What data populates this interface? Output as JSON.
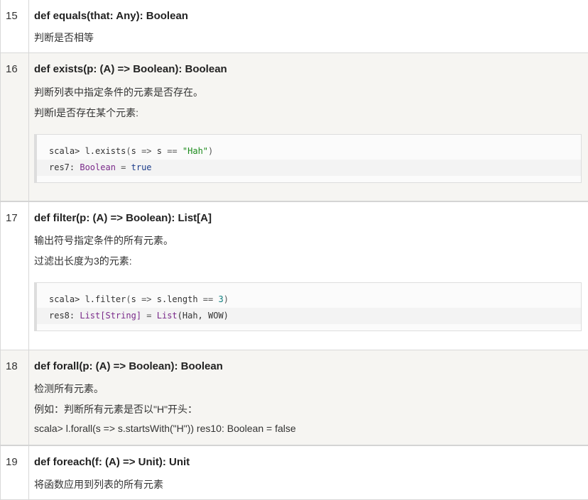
{
  "rows": [
    {
      "num": "15",
      "signature": "def equals(that: Any): Boolean",
      "lines": [
        "判断是否相等"
      ]
    },
    {
      "num": "16",
      "signature": "def exists(p: (A) => Boolean): Boolean",
      "lines": [
        "判断列表中指定条件的元素是否存在。",
        "判断l是否存在某个元素:"
      ],
      "code": {
        "line1": {
          "prompt": "scala> ",
          "call": "l.exists",
          "open": "(",
          "var": "s ",
          "arrow": "=>",
          "rest": " s ",
          "eq": "==",
          "space": " ",
          "str": "\"Hah\"",
          "close": ")"
        },
        "line2": {
          "res": "res7: ",
          "type": "Boolean",
          "eq": " = ",
          "value": "true"
        }
      }
    },
    {
      "num": "17",
      "signature": "def filter(p: (A) => Boolean): List[A]",
      "lines": [
        "输出符号指定条件的所有元素。",
        "过滤出长度为3的元素:"
      ],
      "code": {
        "line1": {
          "prompt": "scala> ",
          "call": "l.filter",
          "open": "(",
          "var": "s ",
          "arrow": "=>",
          "rest": " s.length ",
          "eq": "==",
          "space": " ",
          "num": "3",
          "close": ")"
        },
        "line2": {
          "res": "res8: ",
          "type": "List[String]",
          "eq": " = ",
          "value_type": "List",
          "value_args": "(Hah, WOW)"
        }
      }
    },
    {
      "num": "18",
      "signature": "def forall(p: (A) => Boolean): Boolean",
      "lines": [
        "检测所有元素。",
        "例如：判断所有元素是否以\"H\"开头：",
        "scala> l.forall(s => s.startsWith(\"H\")) res10: Boolean = false"
      ]
    },
    {
      "num": "19",
      "signature": "def foreach(f: (A) => Unit): Unit",
      "lines": [
        "将函数应用到列表的所有元素"
      ]
    }
  ]
}
